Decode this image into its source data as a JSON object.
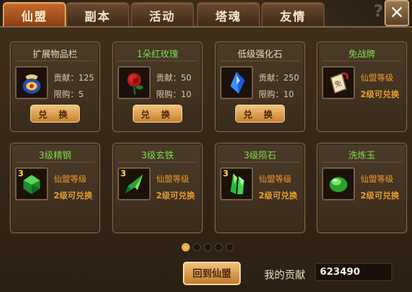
{
  "tabs": [
    {
      "label": "仙盟",
      "active": true
    },
    {
      "label": "副本",
      "active": false
    },
    {
      "label": "活动",
      "active": false
    },
    {
      "label": "塔魂",
      "active": false
    },
    {
      "label": "友情",
      "active": false
    }
  ],
  "help_label": "?",
  "close_label": "✕",
  "exchange_label": "兑 换",
  "cards": [
    {
      "title": "扩展物品栏",
      "title_color": "white",
      "icon": "bag-icon",
      "quantity": "",
      "line1": "贡献：125",
      "line2": "限购：5",
      "button": true
    },
    {
      "title": "1朵红玫瑰",
      "title_color": "green",
      "icon": "rose-icon",
      "quantity": "",
      "line1": "贡献：50",
      "line2": "限购：10",
      "button": true
    },
    {
      "title": "低级强化石",
      "title_color": "white",
      "icon": "blue-crystal-icon",
      "quantity": "",
      "line1": "贡献：250",
      "line2": "限购：10",
      "button": true
    },
    {
      "title": "免战牌",
      "title_color": "green",
      "icon": "token-icon",
      "quantity": "",
      "line1": "仙盟等级",
      "line2": "2级可兑换",
      "button": false
    },
    {
      "title": "3级精钢",
      "title_color": "green",
      "icon": "green-gem-icon",
      "quantity": "3",
      "line1": "仙盟等级",
      "line2": "2级可兑换",
      "button": false
    },
    {
      "title": "3级玄铁",
      "title_color": "green",
      "icon": "green-shard-icon",
      "quantity": "3",
      "line1": "仙盟等级",
      "line2": "2级可兑换",
      "button": false
    },
    {
      "title": "3级陨石",
      "title_color": "green",
      "icon": "green-crystal-icon",
      "quantity": "3",
      "line1": "仙盟等级",
      "line2": "2级可兑换",
      "button": false
    },
    {
      "title": "洗炼玉",
      "title_color": "green",
      "icon": "jade-icon",
      "quantity": "",
      "line1": "仙盟等级",
      "line2": "2级可兑换",
      "button": false
    }
  ],
  "pagination": {
    "total": 5,
    "current": 1
  },
  "return_button": "回到仙盟",
  "contribution": {
    "label": "我的贡献",
    "value": "623490"
  }
}
